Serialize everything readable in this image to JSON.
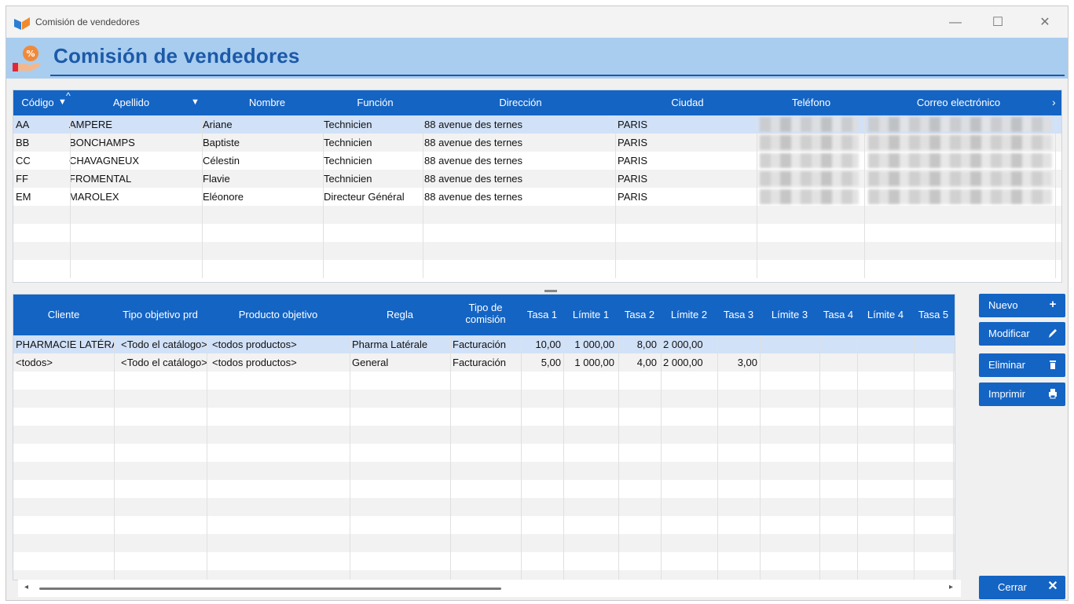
{
  "window": {
    "title": "Comisión de vendedores",
    "header_title": "Comisión de vendedores",
    "minimize": "—",
    "maximize": "☐",
    "close": "✕"
  },
  "vendors": {
    "headers": [
      "Código",
      "Apellido",
      "Nombre",
      "Función",
      "Dirección",
      "Ciudad",
      "Teléfono",
      "Correo electrónico"
    ],
    "rows": [
      {
        "codigo": "AA",
        "apellido": "AMPERE",
        "nombre": "Ariane",
        "funcion": "Technicien",
        "direccion": "88 avenue des ternes",
        "ciudad": "PARIS"
      },
      {
        "codigo": "BB",
        "apellido": "BONCHAMPS",
        "nombre": "Baptiste",
        "funcion": "Technicien",
        "direccion": "88 avenue des ternes",
        "ciudad": "PARIS"
      },
      {
        "codigo": "CC",
        "apellido": "CHAVAGNEUX",
        "nombre": "Célestin",
        "funcion": "Technicien",
        "direccion": "88 avenue des ternes",
        "ciudad": "PARIS"
      },
      {
        "codigo": "FF",
        "apellido": "FROMENTAL",
        "nombre": "Flavie",
        "funcion": "Technicien",
        "direccion": "88 avenue des ternes",
        "ciudad": "PARIS"
      },
      {
        "codigo": "EM",
        "apellido": "MAROLEX",
        "nombre": "Eléonore",
        "funcion": "Directeur Général",
        "direccion": "88 avenue des ternes",
        "ciudad": "PARIS"
      }
    ],
    "selected_index": 0
  },
  "rules": {
    "headers": [
      "Cliente",
      "Tipo objetivo prd",
      "Producto objetivo",
      "Regla",
      "Tipo de comisión",
      "Tasa 1",
      "Límite 1",
      "Tasa 2",
      "Límite 2",
      "Tasa 3",
      "Límite 3",
      "Tasa 4",
      "Límite 4",
      "Tasa 5"
    ],
    "rows": [
      {
        "cliente": "PHARMACIE LATÉRALE",
        "tipo": "<Todo el catálogo>",
        "producto": "<todos productos>",
        "regla": "Pharma Latérale",
        "tipo_comision": "Facturación",
        "tasa1": "10,00",
        "limite1": "1 000,00",
        "tasa2": "8,00",
        "limite2": "2 000,00",
        "tasa3": ""
      },
      {
        "cliente": "<todos>",
        "tipo": "<Todo el catálogo>",
        "producto": "<todos productos>",
        "regla": "General",
        "tipo_comision": "Facturación",
        "tasa1": "5,00",
        "limite1": "1 000,00",
        "tasa2": "4,00",
        "limite2": "2 000,00",
        "tasa3": "3,00"
      }
    ],
    "selected_index": 0
  },
  "buttons": {
    "nuevo": "Nuevo",
    "modificar": "Modificar",
    "eliminar": "Eliminar",
    "imprimir": "Imprimir",
    "cerrar": "Cerrar"
  },
  "colors": {
    "accent": "#1464c4",
    "header_band": "#a9cdef",
    "selection": "#d1e1f7"
  }
}
